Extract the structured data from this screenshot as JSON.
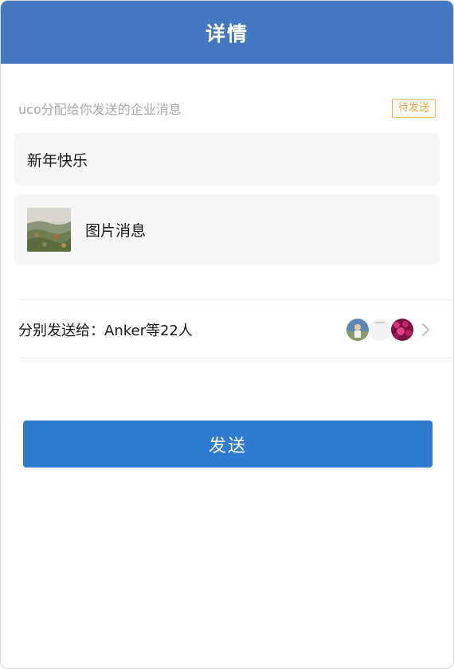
{
  "header": {
    "title": "详情"
  },
  "message": {
    "subtitle": "uco分配给你发送的企业消息",
    "status": "待发送",
    "text_item": "新年快乐",
    "image_item_label": "图片消息"
  },
  "recipients": {
    "label": "分别发送给：Anker等22人",
    "avatars": [
      "avatar-person",
      "avatar-blank",
      "avatar-flowers"
    ]
  },
  "actions": {
    "send_label": "发送"
  },
  "colors": {
    "header_bg": "#4479c2",
    "button_bg": "#2f7bd1",
    "badge": "#f0a23a",
    "card_bg": "#f6f6f6"
  }
}
